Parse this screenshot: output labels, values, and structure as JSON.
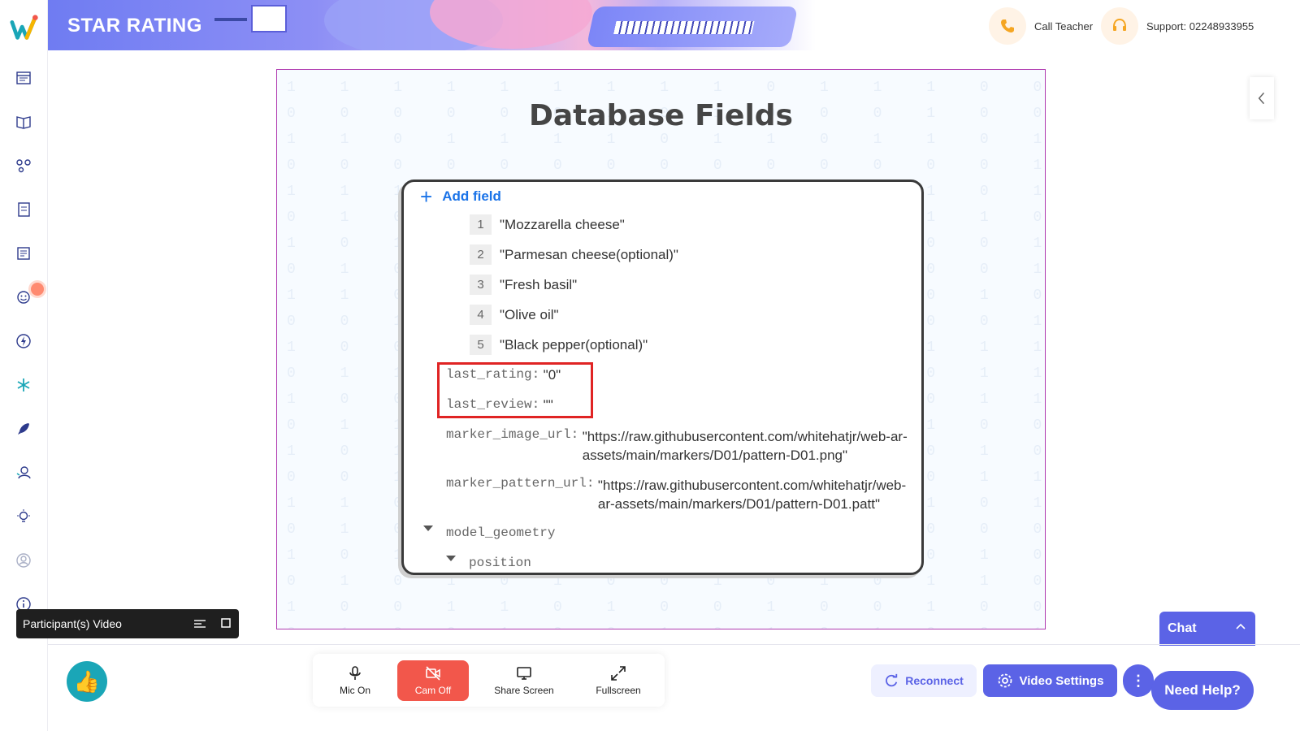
{
  "app": {
    "logo_letter": "W"
  },
  "header": {
    "banner_title": "STAR RATING",
    "call_teacher": "Call Teacher",
    "support": "Support: 02248933955"
  },
  "sidebar": {
    "items": [
      {
        "icon": "calendar-icon"
      },
      {
        "icon": "book-icon"
      },
      {
        "icon": "network-icon"
      },
      {
        "icon": "notebook-icon"
      },
      {
        "icon": "document-icon"
      },
      {
        "icon": "smiley-icon",
        "notification": true
      },
      {
        "icon": "bolt-icon"
      },
      {
        "icon": "snowflake-icon"
      },
      {
        "icon": "rocket-icon"
      },
      {
        "icon": "user-support-icon"
      },
      {
        "icon": "bulb-icon"
      },
      {
        "icon": "profile-icon"
      },
      {
        "icon": "info-icon"
      }
    ]
  },
  "slide": {
    "title": "Database Fields",
    "add_field": "Add field",
    "ingredients": [
      {
        "index": "1",
        "value": "\"Mozzarella cheese\""
      },
      {
        "index": "2",
        "value": "\"Parmesan cheese(optional)\""
      },
      {
        "index": "3",
        "value": "\"Fresh basil\""
      },
      {
        "index": "4",
        "value": "\"Olive oil\""
      },
      {
        "index": "5",
        "value": "\"Black pepper(optional)\""
      }
    ],
    "fields": {
      "last_rating_key": "last_rating:",
      "last_rating_val": "\"0\"",
      "last_review_key": "last_review:",
      "last_review_val": "\"\"",
      "marker_image_key": "marker_image_url:",
      "marker_image_val_1": "\"https://raw.githubusercontent.com/whitehatjr/web-ar-",
      "marker_image_val_2": "assets/main/markers/D01/pattern-D01.png\"",
      "marker_pattern_key": "marker_pattern_url:",
      "marker_pattern_val_1": "\"https://raw.githubusercontent.com/whitehatjr/web-",
      "marker_pattern_val_2": "ar-assets/main/markers/D01/pattern-D01.patt\"",
      "model_geometry": "model_geometry",
      "position": "position"
    },
    "highlight_color": "#e02424"
  },
  "participant_video": {
    "label": "Participant(s) Video"
  },
  "controls": {
    "mic": "Mic On",
    "cam": "Cam Off",
    "share": "Share Screen",
    "fullscreen": "Fullscreen"
  },
  "actions": {
    "reconnect": "Reconnect",
    "video_settings": "Video Settings",
    "chat": "Chat",
    "need_help": "Need Help?"
  },
  "colors": {
    "accent": "#5b63e6",
    "cam_off": "#f2574b",
    "slide_border": "#b03ab0"
  }
}
